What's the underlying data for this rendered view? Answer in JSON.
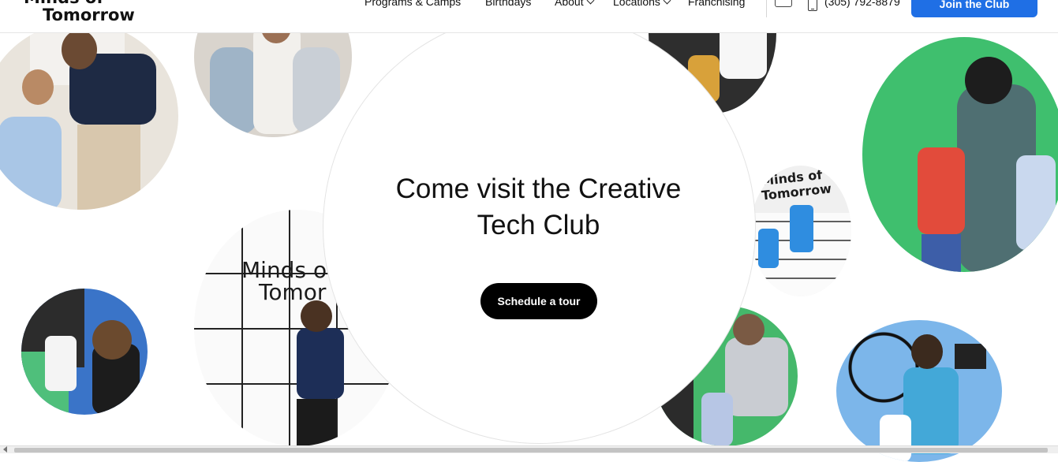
{
  "header": {
    "logo_line1": "Minds of",
    "logo_line2": "Tomorrow",
    "nav": [
      "Programs & Camps",
      "Birthdays",
      "About",
      "Locations",
      "Franchising"
    ],
    "phone": "(305) 792-8879",
    "join_label": "Join the Club"
  },
  "hero": {
    "headline_line1": "Come visit the Creative",
    "headline_line2": "Tech Club",
    "cta_label": "Schedule a tour",
    "sign_text_1": "Minds o",
    "sign_text_2": "Tomor",
    "sign_text_3": "Minds of",
    "sign_text_4": "Tomorrow"
  },
  "colors": {
    "accent": "#1f6fe5",
    "cta": "#000000",
    "green_screen": "#3fbf6e",
    "wall_blue": "#4a90d9"
  },
  "icons": [
    "mail-icon",
    "phone-icon",
    "chevron-down-icon"
  ]
}
